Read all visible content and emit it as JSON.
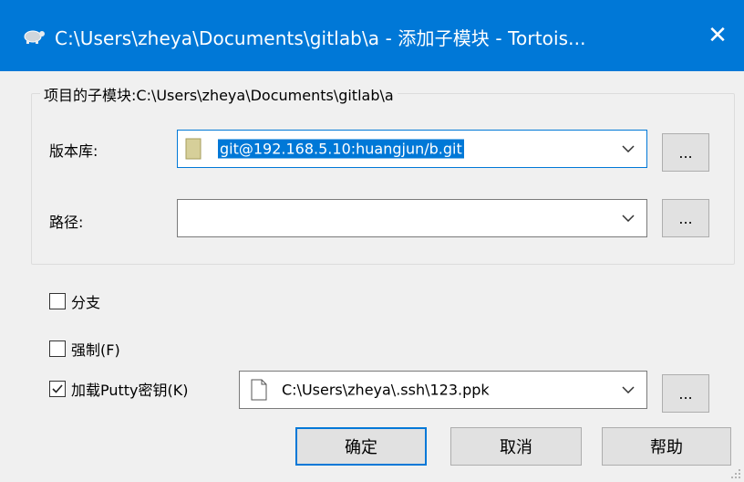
{
  "window": {
    "title": "C:\\Users\\zheya\\Documents\\gitlab\\a - 添加子模块 - Tortois...",
    "close_glyph": "✕",
    "accent": "#0078d7",
    "app_icon": "tortoise-icon"
  },
  "group": {
    "title": "项目的子模块:C:\\Users\\zheya\\Documents\\gitlab\\a"
  },
  "repository": {
    "label": "版本库:",
    "value": "git@192.168.5.10:huangjun/b.git",
    "browse_label": "..."
  },
  "path": {
    "label": "路径:",
    "value": "",
    "browse_label": "..."
  },
  "options": {
    "branch": {
      "label": "分支",
      "checked": false
    },
    "force": {
      "label": "强制(F)",
      "checked": false
    },
    "putty": {
      "label": "加载Putty密钥(K)",
      "checked": true
    }
  },
  "putty_key": {
    "value": "C:\\Users\\zheya\\.ssh\\123.ppk",
    "browse_label": "..."
  },
  "buttons": {
    "ok": "确定",
    "cancel": "取消",
    "help": "帮助"
  }
}
